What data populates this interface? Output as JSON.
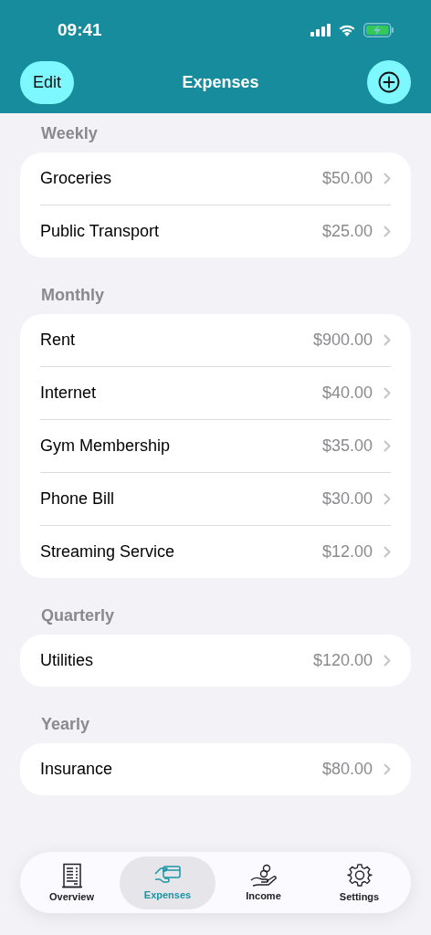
{
  "status_bar": {
    "time": "09:41"
  },
  "nav": {
    "edit": "Edit",
    "title": "Expenses"
  },
  "sections": [
    {
      "title": "Weekly",
      "items": [
        {
          "name": "Groceries",
          "amount": "$50.00"
        },
        {
          "name": "Public Transport",
          "amount": "$25.00"
        }
      ]
    },
    {
      "title": "Monthly",
      "items": [
        {
          "name": "Rent",
          "amount": "$900.00"
        },
        {
          "name": "Internet",
          "amount": "$40.00"
        },
        {
          "name": "Gym Membership",
          "amount": "$35.00"
        },
        {
          "name": "Phone Bill",
          "amount": "$30.00"
        },
        {
          "name": "Streaming Service",
          "amount": "$12.00"
        }
      ]
    },
    {
      "title": "Quarterly",
      "items": [
        {
          "name": "Utilities",
          "amount": "$120.00"
        }
      ]
    },
    {
      "title": "Yearly",
      "items": [
        {
          "name": "Insurance",
          "amount": "$80.00"
        }
      ]
    }
  ],
  "tabs": [
    {
      "label": "Overview",
      "kind": "overview",
      "selected": false
    },
    {
      "label": "Expenses",
      "kind": "expenses",
      "selected": true
    },
    {
      "label": "Income",
      "kind": "income",
      "selected": false
    },
    {
      "label": "Settings",
      "kind": "settings",
      "selected": false
    }
  ]
}
